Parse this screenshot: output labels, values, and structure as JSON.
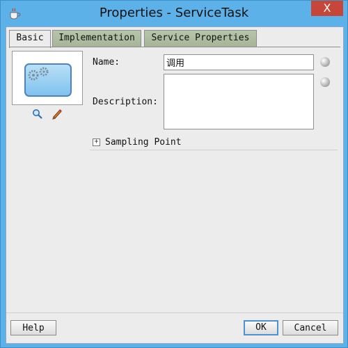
{
  "window": {
    "title": "Properties - ServiceTask",
    "close_label": "X"
  },
  "tabs": [
    {
      "label": "Basic",
      "active": true
    },
    {
      "label": "Implementation",
      "active": false
    },
    {
      "label": "Service Properties",
      "active": false
    }
  ],
  "form": {
    "name_label": "Name:",
    "name_value": "调用",
    "description_label": "Description:",
    "description_value": "",
    "sampling_expander": "+",
    "sampling_label": "Sampling Point"
  },
  "icons": {
    "app": "coffee-cup-icon",
    "node": "service-task-gears-icon",
    "search": "magnifier-icon",
    "edit": "pencil-icon",
    "translate": "globe-icon"
  },
  "buttons": {
    "help": "Help",
    "ok": "OK",
    "cancel": "Cancel"
  },
  "colors": {
    "titlebar": "#5bb1e8",
    "close": "#c7463a",
    "tab_inactive": "#a9b79a",
    "accent": "#4f90d0"
  }
}
